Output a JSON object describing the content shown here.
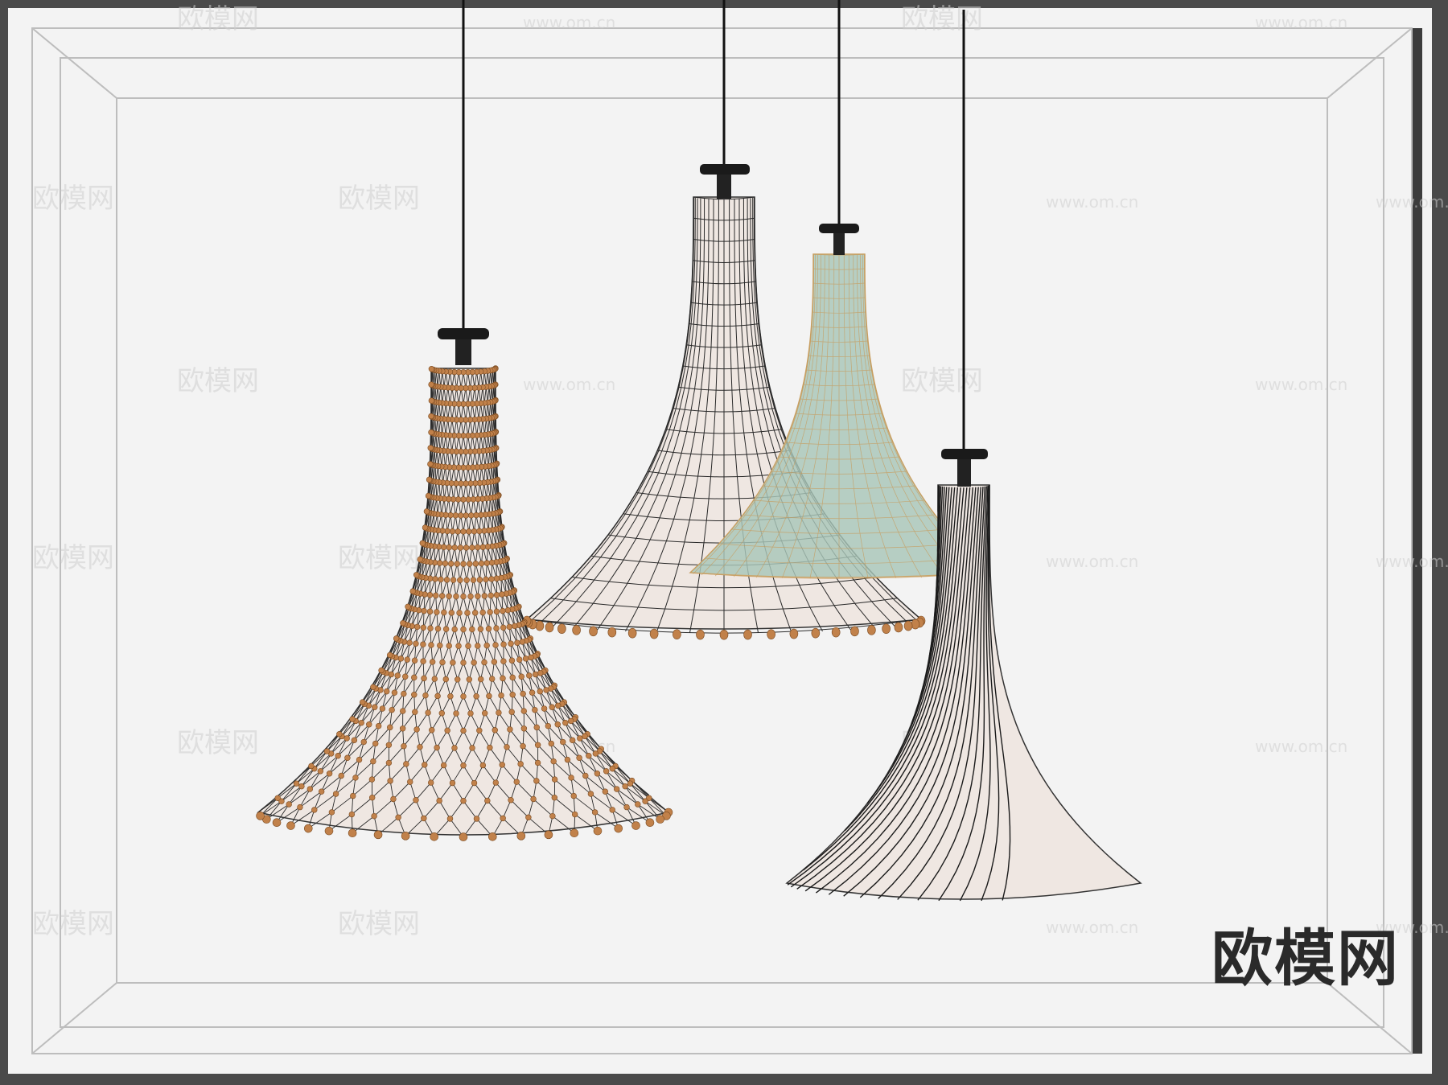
{
  "render": {
    "view": "wireframe 3D render",
    "subject": "four trumpet-shaped pendant lamps",
    "colors": {
      "outer_frame": "#4a4a4a",
      "background": "#f3f3f3",
      "frame_line": "#bdbdbd",
      "shade_fill": "#efe7e2",
      "wire": "#1a1a1a",
      "bead": "#c1814a",
      "green_shade": "#a8c6b8",
      "cord": "#111111"
    }
  },
  "lamps": [
    {
      "name": "beaded-net-shade",
      "pattern": "diamond net with wooden beads",
      "color": "#efe7e2"
    },
    {
      "name": "grid-shade",
      "pattern": "rectangular grid with bead rim",
      "color": "#efe7e2"
    },
    {
      "name": "translucent-green-shade",
      "pattern": "fine mesh",
      "color": "#a8c6b8"
    },
    {
      "name": "spiral-shade",
      "pattern": "spiral lines",
      "color": "#efe7e2"
    }
  ],
  "watermark": {
    "site_text": "www.om.cn",
    "brand_text": "欧模网"
  },
  "logo": {
    "text": "欧模网"
  }
}
